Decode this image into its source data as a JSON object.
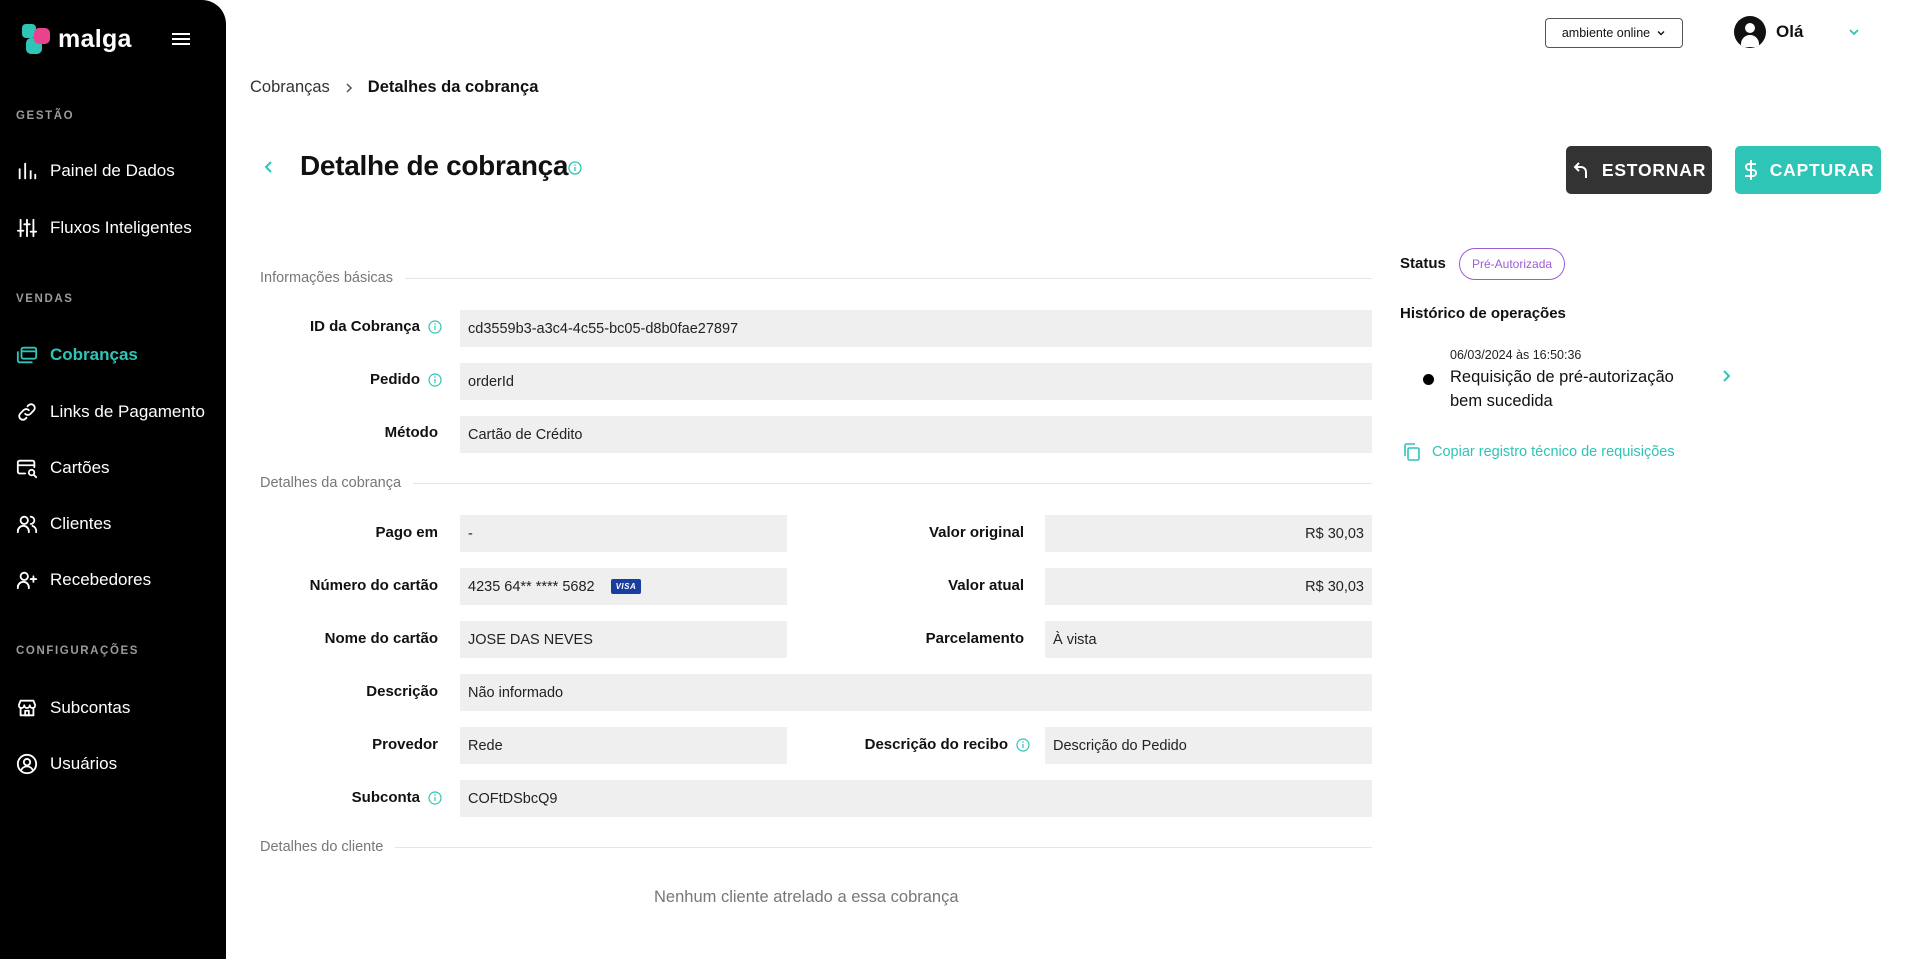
{
  "sidebar": {
    "logo_text": "malga",
    "sections": {
      "gestao": "GESTÃO",
      "vendas": "VENDAS",
      "config": "CONFIGURAÇÕES"
    },
    "items": {
      "painel": "Painel de Dados",
      "fluxos": "Fluxos Inteligentes",
      "cobrancas": "Cobranças",
      "links": "Links de Pagamento",
      "cartoes": "Cartões",
      "clientes": "Clientes",
      "recebedores": "Recebedores",
      "subcontas": "Subcontas",
      "usuarios": "Usuários"
    }
  },
  "topbar": {
    "environment": "ambiente online",
    "greeting": "Olá"
  },
  "breadcrumb": {
    "parent": "Cobranças",
    "current": "Detalhes da cobrança"
  },
  "header": {
    "title": "Detalhe de cobrança",
    "estornar_label": "ESTORNAR",
    "capturar_label": "CAPTURAR"
  },
  "sections": {
    "basic": "Informações básicas",
    "details": "Detalhes da cobrança",
    "client": "Detalhes do cliente"
  },
  "fields": {
    "id_label": "ID da Cobrança",
    "id_value": "cd3559b3-a3c4-4c55-bc05-d8b0fae27897",
    "pedido_label": "Pedido",
    "pedido_value": "orderId",
    "metodo_label": "Método",
    "metodo_value": "Cartão de Crédito",
    "pago_label": "Pago em",
    "pago_value": "-",
    "valor_original_label": "Valor original",
    "valor_original_value": "R$ 30,03",
    "numero_label": "Número do cartão",
    "numero_value": "4235 64** **** 5682",
    "card_brand": "VISA",
    "valor_atual_label": "Valor atual",
    "valor_atual_value": "R$ 30,03",
    "nome_label": "Nome do cartão",
    "nome_value": "JOSE DAS NEVES",
    "parcelamento_label": "Parcelamento",
    "parcelamento_value": "À vista",
    "descricao_label": "Descrição",
    "descricao_value": "Não informado",
    "provedor_label": "Provedor",
    "provedor_value": "Rede",
    "recibo_label": "Descrição do recibo",
    "recibo_value": "Descrição do Pedido",
    "subconta_label": "Subconta",
    "subconta_value": "COFtDSbcQ9"
  },
  "client": {
    "empty_message": "Nenhum cliente atrelado a essa cobrança"
  },
  "status": {
    "label": "Status",
    "badge": "Pré-Autorizada",
    "badge_color": "#9c5dd6"
  },
  "history": {
    "title": "Histórico de operações",
    "entries": [
      {
        "date": "06/03/2024 às 16:50:36",
        "text": "Requisição de pré-autorização bem sucedida"
      }
    ],
    "copy_link": "Copiar registro técnico de requisições"
  },
  "colors": {
    "accent": "#2ec4b6",
    "sidebar_bg": "#000000",
    "estornar_bg": "#333333"
  }
}
